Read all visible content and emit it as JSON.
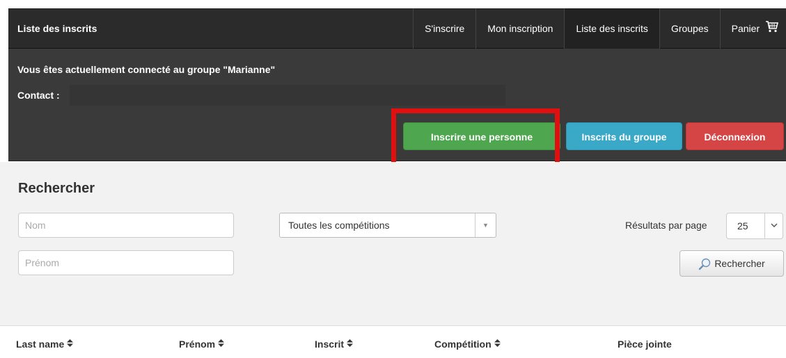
{
  "navbar": {
    "brand": "Liste des inscrits",
    "items": [
      {
        "label": "S'inscrire",
        "active": false
      },
      {
        "label": "Mon inscription",
        "active": false
      },
      {
        "label": "Liste des inscrits",
        "active": true
      },
      {
        "label": "Groupes",
        "active": false
      },
      {
        "label": "Panier",
        "active": false,
        "icon": "cart-icon"
      }
    ]
  },
  "group_panel": {
    "connected_text": "Vous êtes actuellement connecté au groupe \"Marianne\"",
    "contact_label": "Contact :",
    "buttons": {
      "register_person": "Inscrire une personne",
      "group_members": "Inscrits du groupe",
      "logout": "Déconnexion"
    },
    "colors": {
      "green": "#4ea64e",
      "blue": "#3aa9c8",
      "red": "#d64545",
      "highlight": "#e01010"
    }
  },
  "search": {
    "title": "Rechercher",
    "last_name_placeholder": "Nom",
    "first_name_placeholder": "Prénom",
    "competition_selected": "Toutes les compétitions",
    "results_per_page_label": "Résultats par page",
    "results_per_page_value": "25",
    "search_button": "Rechercher",
    "search_icon": "magnifier-icon"
  },
  "table": {
    "columns": [
      "Last name",
      "Prénom",
      "Inscrit",
      "Compétition",
      "Pièce jointe"
    ],
    "sortable": [
      true,
      true,
      true,
      true,
      false
    ]
  }
}
